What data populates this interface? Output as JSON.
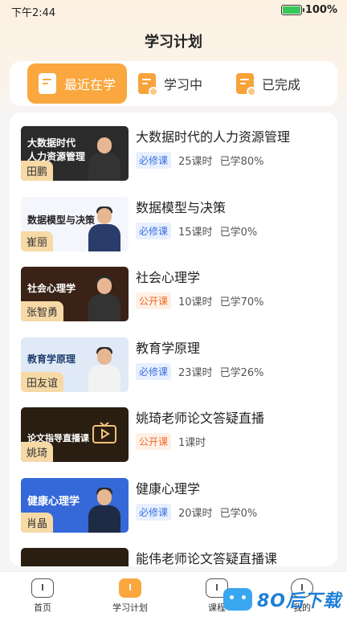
{
  "status": {
    "time": "下午2:44",
    "battery": "100%"
  },
  "header": {
    "title": "学习计划"
  },
  "tabs": [
    {
      "label": "最近在学",
      "active": true
    },
    {
      "label": "学习中",
      "active": false
    },
    {
      "label": "已完成",
      "active": false
    }
  ],
  "courses": [
    {
      "title": "大数据时代的人力资源管理",
      "tag": "必修课",
      "tag_type": "required",
      "lessons": "25课时",
      "progress": "已学80%",
      "teacher": "田鹏",
      "thumb_title": "大数据时代\n人力资源管理",
      "thumb_color": "#2b2b2b"
    },
    {
      "title": "数据模型与决策",
      "tag": "必修课",
      "tag_type": "required",
      "lessons": "15课时",
      "progress": "已学0%",
      "teacher": "崔丽",
      "thumb_title": "数据模型与决策",
      "thumb_color": "#f4f6fb"
    },
    {
      "title": "社会心理学",
      "tag": "公开课",
      "tag_type": "public",
      "lessons": "10课时",
      "progress": "已学70%",
      "teacher": "张智勇",
      "thumb_title": "社会心理学",
      "thumb_color": "#3a2316"
    },
    {
      "title": "教育学原理",
      "tag": "必修课",
      "tag_type": "required",
      "lessons": "23课时",
      "progress": "已学26%",
      "teacher": "田友谊",
      "thumb_title": "教育学原理",
      "thumb_color": "#dfeaf6"
    },
    {
      "title": "姚琦老师论文答疑直播",
      "tag": "公开课",
      "tag_type": "public",
      "lessons": "1课时",
      "progress": "",
      "teacher": "姚琦",
      "thumb_title": "论文指导直播课",
      "thumb_color": "#2a1e12"
    },
    {
      "title": "健康心理学",
      "tag": "必修课",
      "tag_type": "required",
      "lessons": "20课时",
      "progress": "已学0%",
      "teacher": "肖晶",
      "thumb_title": "健康心理学",
      "thumb_color": "#3568d8"
    },
    {
      "title": "能伟老师论文答疑直播课",
      "tag": "",
      "tag_type": "",
      "lessons": "",
      "progress": "",
      "teacher": "",
      "thumb_title": "",
      "thumb_color": "#2a1e12"
    }
  ],
  "bottom_nav": [
    {
      "label": "首页",
      "icon": "home-icon",
      "active": false
    },
    {
      "label": "学习计划",
      "icon": "book-icon",
      "active": true
    },
    {
      "label": "课程",
      "icon": "course-icon",
      "active": false
    },
    {
      "label": "我的",
      "icon": "profile-icon",
      "active": false
    }
  ],
  "watermark": {
    "text": "8O后下载",
    "color": "#1d7fd6"
  }
}
